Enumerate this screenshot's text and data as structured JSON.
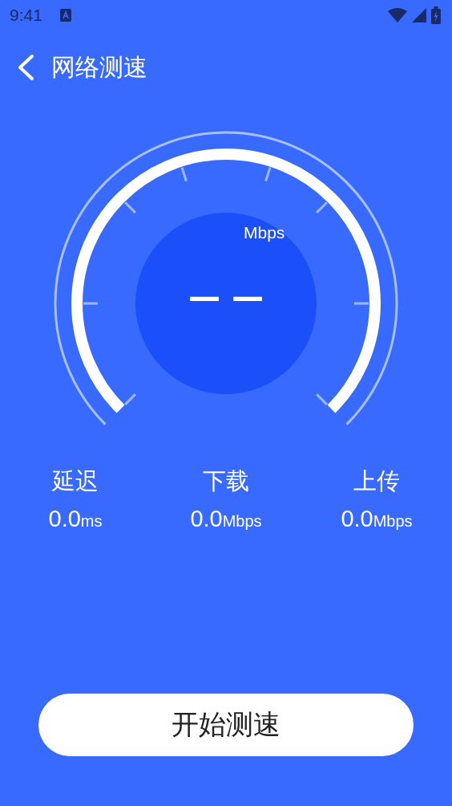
{
  "status_bar": {
    "time": "9:41"
  },
  "header": {
    "title": "网络测速"
  },
  "gauge": {
    "unit": "Mbps",
    "reading": "— —"
  },
  "stats": [
    {
      "label": "延迟",
      "value": "0.0",
      "unit": "ms"
    },
    {
      "label": "下载",
      "value": "0.0",
      "unit": "Mbps"
    },
    {
      "label": "上传",
      "value": "0.0",
      "unit": "Mbps"
    }
  ],
  "start_button": {
    "label": "开始测速"
  }
}
